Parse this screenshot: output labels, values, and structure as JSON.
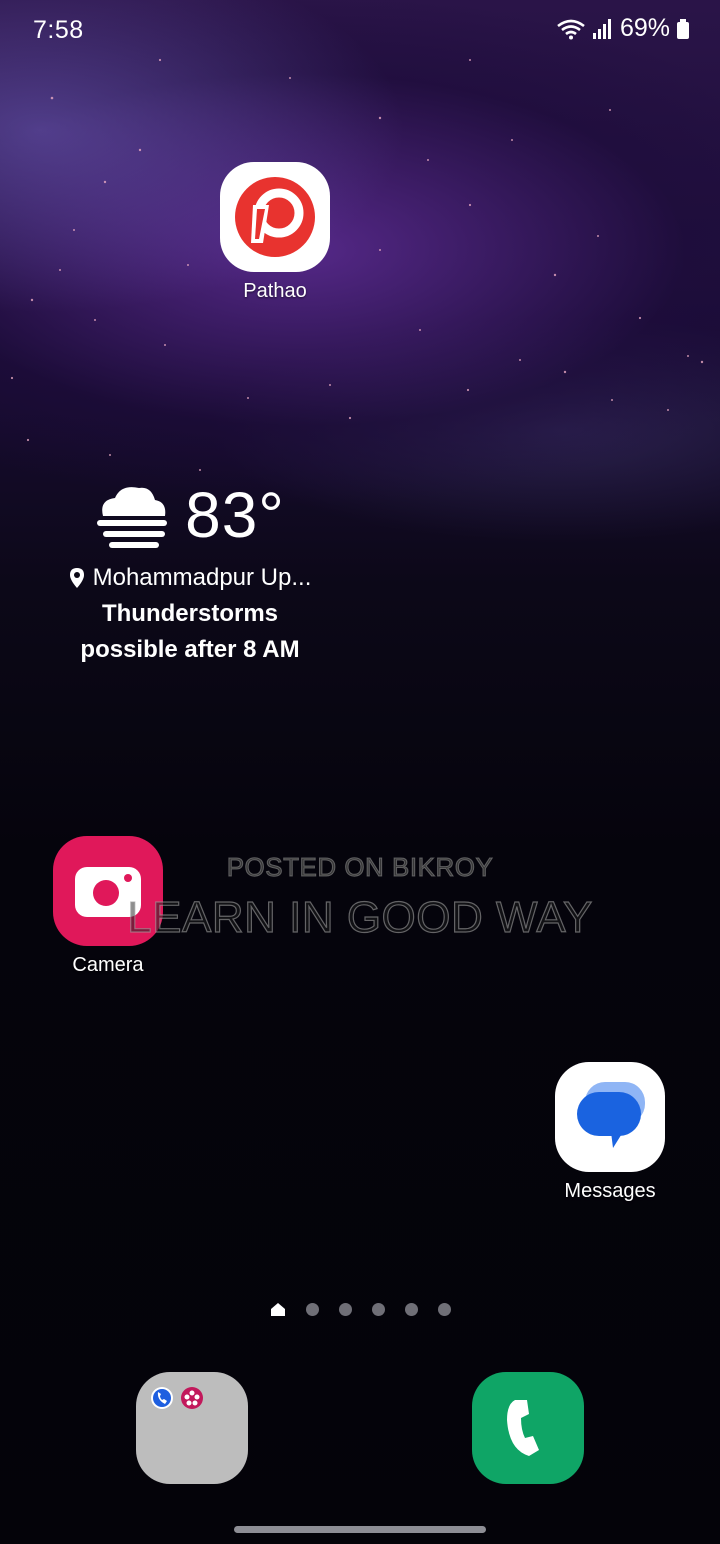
{
  "status_bar": {
    "time": "7:58",
    "battery_percent": "69%",
    "icons": [
      "wifi-icon",
      "signal-icon",
      "battery-icon"
    ]
  },
  "apps": {
    "pathao": {
      "label": "Pathao",
      "icon": "pathao-logo-icon",
      "color": "#e8332f"
    },
    "camera": {
      "label": "Camera",
      "icon": "camera-icon",
      "color": "#e0185a"
    },
    "messages": {
      "label": "Messages",
      "icon": "messages-icon",
      "color": "#1a63e0"
    }
  },
  "weather_widget": {
    "temperature": "83°",
    "icon": "fog-cloud-icon",
    "location": "Mohammadpur Up...",
    "condition_line1": "Thunderstorms",
    "condition_line2": "possible after 8 AM"
  },
  "watermark": {
    "line1": "POSTED ON BIKROY",
    "line2": "LEARN IN GOOD WAY"
  },
  "page_indicator": {
    "pages": 6,
    "current": 1,
    "first_icon": "home-icon"
  },
  "dock": {
    "folder": {
      "icon": "folder-icon",
      "mini_apps": [
        "phone-mini-icon",
        "bixby-mini-icon"
      ]
    },
    "phone": {
      "icon": "phone-icon",
      "color": "#0fa566"
    }
  }
}
